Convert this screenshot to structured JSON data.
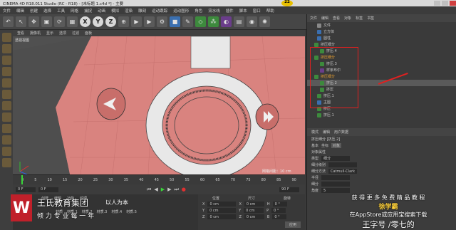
{
  "window": {
    "title": "CINEMA 4D R18.011 Studio (RC - R18) - [未标题 1.c4d *] - 主要",
    "frame_number": "22"
  },
  "menu": [
    "文件",
    "编辑",
    "创建",
    "选择",
    "工具",
    "网格",
    "捕捉",
    "动画",
    "模拟",
    "渲染",
    "雕刻",
    "运动跟踪",
    "运动图形",
    "角色",
    "流水线",
    "插件",
    "脚本",
    "窗口",
    "帮助"
  ],
  "toolbar": {
    "axis_x": "X",
    "axis_y": "Y",
    "axis_z": "Z"
  },
  "viewport": {
    "menu": [
      "查看",
      "摄像机",
      "显示",
      "选项",
      "过滤",
      "面板"
    ],
    "label": "透视视图",
    "grid_info": "网格间距：10 cm"
  },
  "timeline": {
    "ticks": [
      "0",
      "5",
      "10",
      "15",
      "20",
      "25",
      "30",
      "35",
      "40",
      "45",
      "50",
      "55",
      "60",
      "65",
      "70",
      "75",
      "80",
      "85",
      "90"
    ],
    "start": "0 F",
    "current": "0 F",
    "end": "90 F"
  },
  "materials": {
    "menu": [
      "创建",
      "编辑",
      "功能",
      "纹理"
    ],
    "items": [
      "材质",
      "材质.1",
      "材质.2",
      "材质.3",
      "材质.4",
      "材质.5"
    ]
  },
  "coords": {
    "headers": [
      "位置",
      "尺寸",
      "旋转"
    ],
    "rows": [
      [
        "X",
        "0 cm",
        "X",
        "0 cm",
        "H",
        "0 °"
      ],
      [
        "Y",
        "0 cm",
        "Y",
        "0 cm",
        "P",
        "0 °"
      ],
      [
        "Z",
        "0 cm",
        "Z",
        "0 cm",
        "B",
        "0 °"
      ]
    ],
    "apply": "应用"
  },
  "objects": {
    "tabs": [
      "文件",
      "编辑",
      "查看",
      "对象",
      "标签",
      "书签"
    ],
    "rows": [
      "文件",
      "立方体",
      "圆柱",
      "挤压细分",
      "挤压.4",
      "挤压细分",
      "挤压.3",
      "样条布尔",
      "挤压细分",
      "挤压.2",
      "挤压",
      "挤压.1",
      "主圆",
      "挤压",
      "挤压.1"
    ]
  },
  "attributes": {
    "tabs": [
      "模式",
      "编辑",
      "用户数据"
    ],
    "object_name": "挤压细分 [挤压.2]",
    "subtabs": [
      "基本",
      "坐标",
      "对象"
    ],
    "section": "对象属性",
    "rows": [
      [
        "类型",
        "细分"
      ],
      [
        "细分级别",
        ""
      ],
      [
        "细分方法",
        "Catmull-Clark"
      ],
      [
        "半径",
        ""
      ],
      [
        "细分",
        ""
      ],
      [
        "角度",
        "5"
      ]
    ]
  },
  "watermark": {
    "company": "王氏教育集团",
    "slogan": "以人为本",
    "sub": "倾   力      专   业       每   一   年",
    "promo1": "获 得 更 多 免 费 精 品 教 程",
    "promo2": "徐学霸",
    "promo3": "在AppStore或应用宝搜索下载",
    "promo4": "王字号 /零七的"
  }
}
